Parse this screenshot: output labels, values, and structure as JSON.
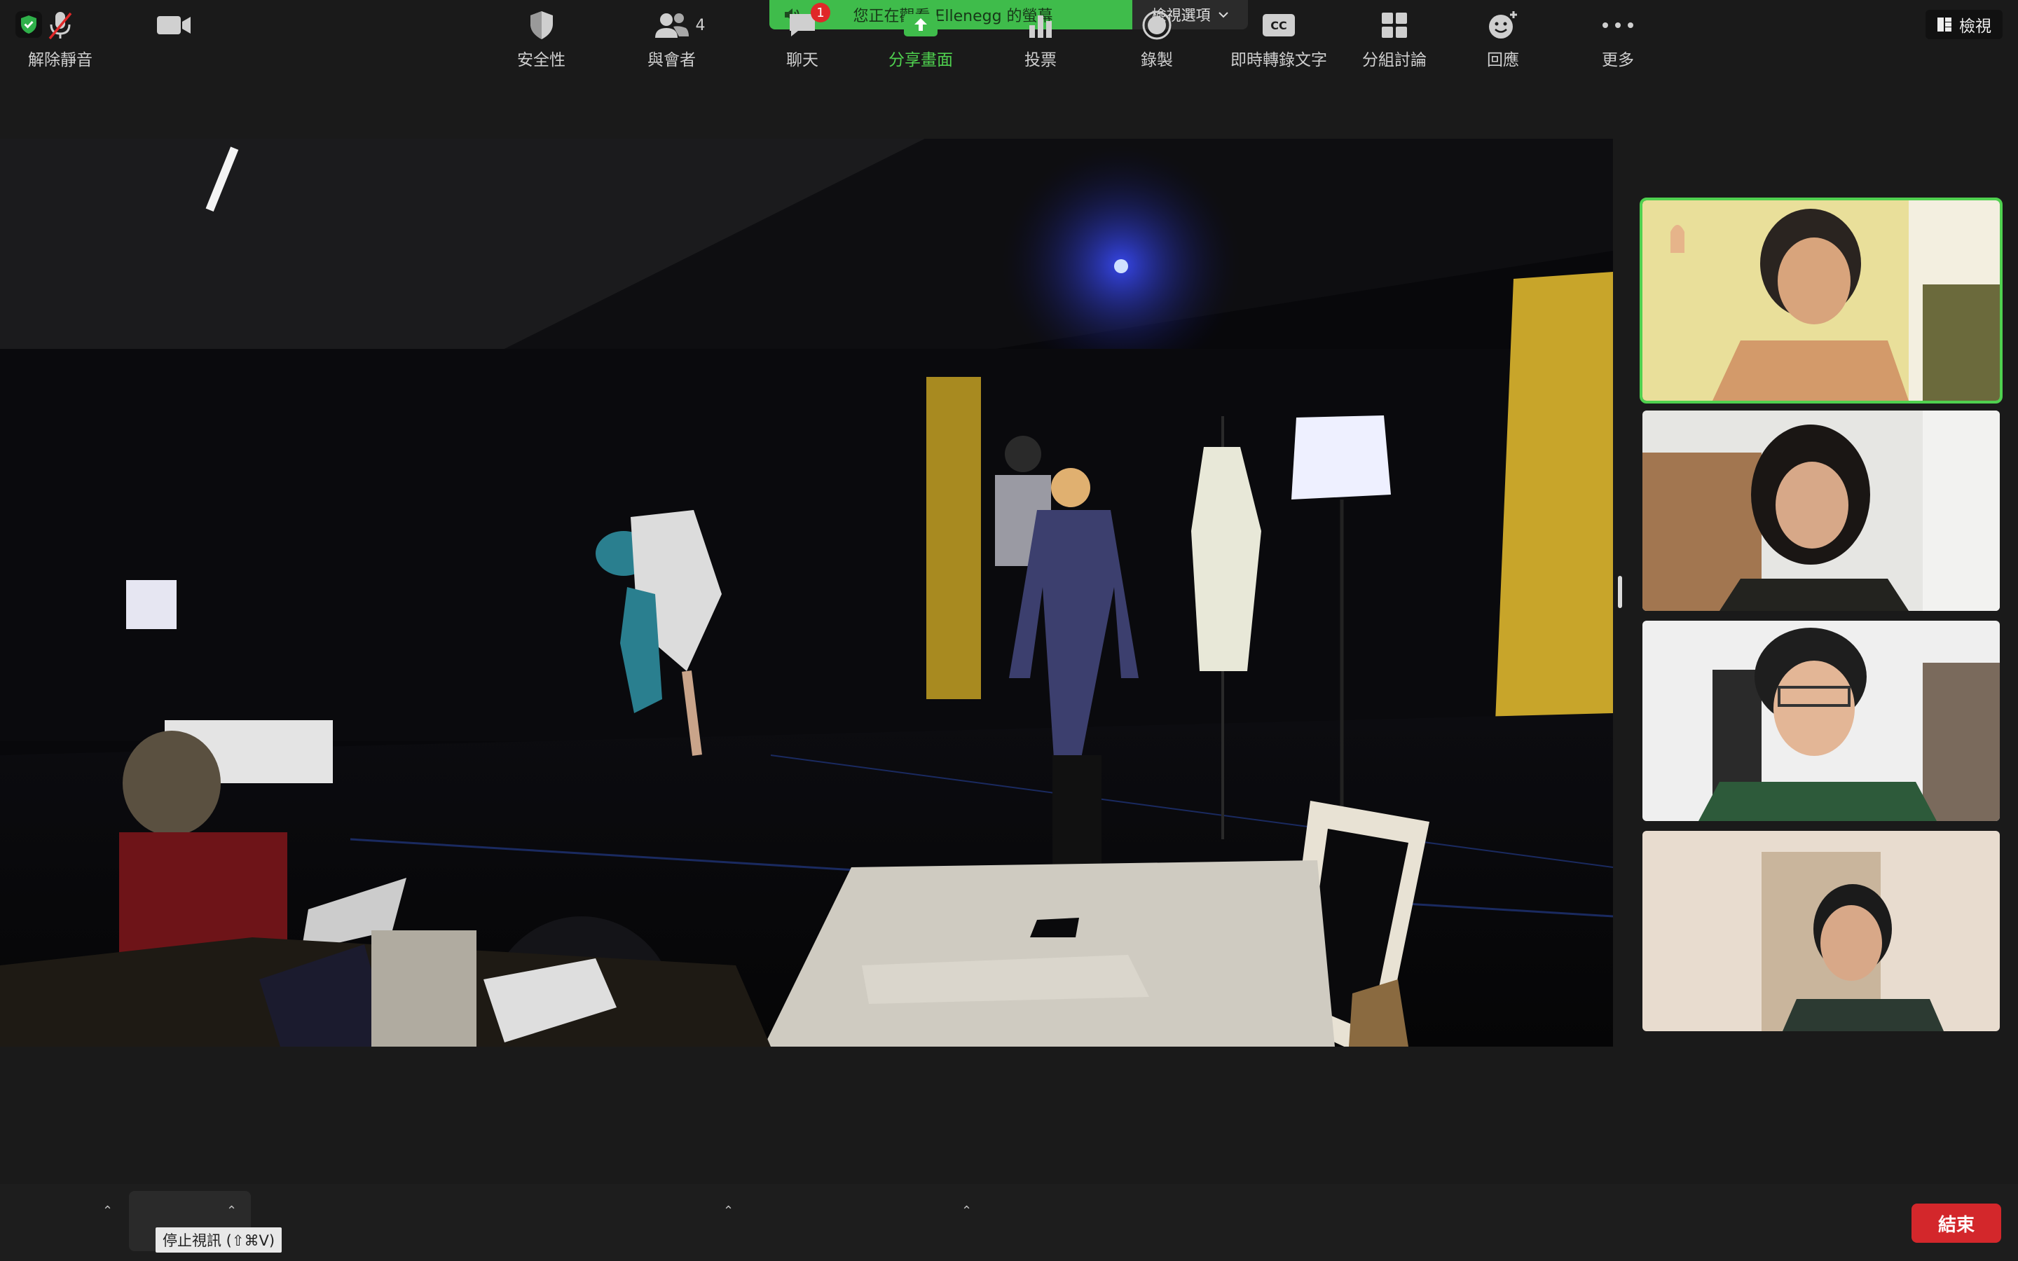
{
  "top_bar": {
    "share_banner_text": "您正在觀看 Ellenegg 的螢幕",
    "view_options_label": "檢視選項",
    "view_button_label": "檢視"
  },
  "participants_count": "4",
  "chat_badge": "1",
  "toolbar": {
    "unmute_label": "解除靜音",
    "stop_video_label": "停止視訊",
    "stop_video_tooltip": "停止視訊 (⇧⌘V)",
    "security_label": "安全性",
    "participants_label": "與會者",
    "chat_label": "聊天",
    "share_screen_label": "分享畫面",
    "polls_label": "投票",
    "record_label": "錄製",
    "captions_label": "即時轉錄文字",
    "captions_icon_text": "CC",
    "breakout_label": "分組討論",
    "reactions_label": "回應",
    "more_label": "更多",
    "end_label": "結束"
  },
  "colors": {
    "accent_green": "#3fbc4b",
    "end_red": "#d3272b",
    "toolbar_bg": "#1d1d1d"
  }
}
